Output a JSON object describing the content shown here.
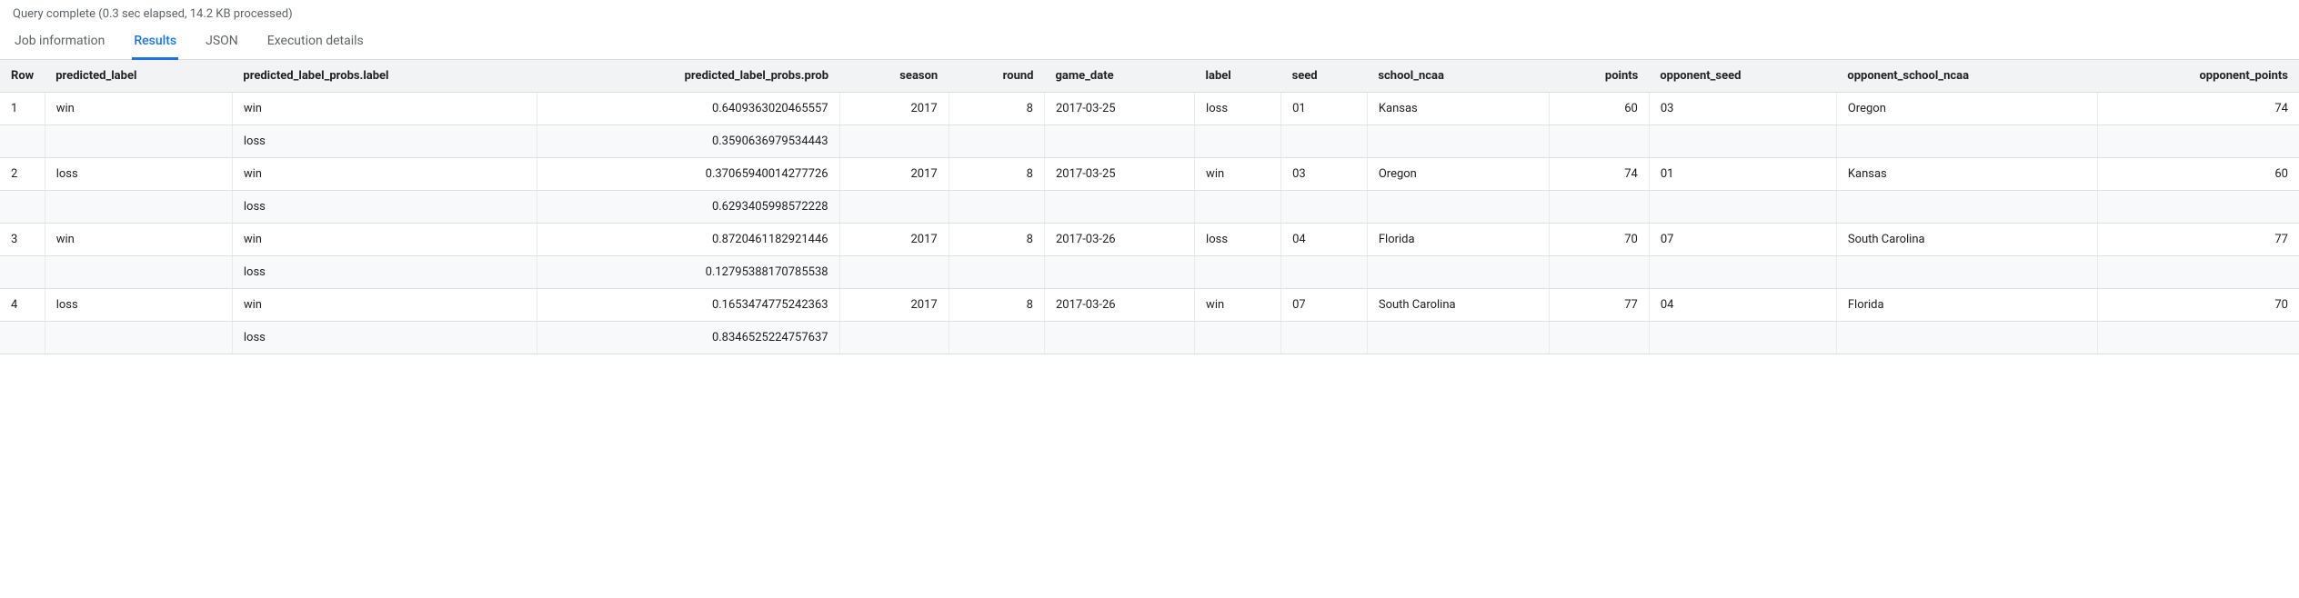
{
  "status": "Query complete (0.3 sec elapsed, 14.2 KB processed)",
  "tabs": {
    "job_info": "Job information",
    "results": "Results",
    "json": "JSON",
    "execution": "Execution details"
  },
  "columns": {
    "row": "Row",
    "predicted_label": "predicted_label",
    "probs_label": "predicted_label_probs.label",
    "probs_prob": "predicted_label_probs.prob",
    "season": "season",
    "round": "round",
    "game_date": "game_date",
    "label": "label",
    "seed": "seed",
    "school": "school_ncaa",
    "points": "points",
    "opp_seed": "opponent_seed",
    "opp_school": "opponent_school_ncaa",
    "opp_points": "opponent_points"
  },
  "rows": [
    {
      "row": "1",
      "predicted_label": "win",
      "probs": [
        {
          "label": "win",
          "prob": "0.6409363020465557"
        },
        {
          "label": "loss",
          "prob": "0.3590636979534443"
        }
      ],
      "season": "2017",
      "round": "8",
      "game_date": "2017-03-25",
      "label": "loss",
      "seed": "01",
      "school": "Kansas",
      "points": "60",
      "opp_seed": "03",
      "opp_school": "Oregon",
      "opp_points": "74"
    },
    {
      "row": "2",
      "predicted_label": "loss",
      "probs": [
        {
          "label": "win",
          "prob": "0.37065940014277726"
        },
        {
          "label": "loss",
          "prob": "0.6293405998572228"
        }
      ],
      "season": "2017",
      "round": "8",
      "game_date": "2017-03-25",
      "label": "win",
      "seed": "03",
      "school": "Oregon",
      "points": "74",
      "opp_seed": "01",
      "opp_school": "Kansas",
      "opp_points": "60"
    },
    {
      "row": "3",
      "predicted_label": "win",
      "probs": [
        {
          "label": "win",
          "prob": "0.8720461182921446"
        },
        {
          "label": "loss",
          "prob": "0.12795388170785538"
        }
      ],
      "season": "2017",
      "round": "8",
      "game_date": "2017-03-26",
      "label": "loss",
      "seed": "04",
      "school": "Florida",
      "points": "70",
      "opp_seed": "07",
      "opp_school": "South Carolina",
      "opp_points": "77"
    },
    {
      "row": "4",
      "predicted_label": "loss",
      "probs": [
        {
          "label": "win",
          "prob": "0.1653474775242363"
        },
        {
          "label": "loss",
          "prob": "0.8346525224757637"
        }
      ],
      "season": "2017",
      "round": "8",
      "game_date": "2017-03-26",
      "label": "win",
      "seed": "07",
      "school": "South Carolina",
      "points": "77",
      "opp_seed": "04",
      "opp_school": "Florida",
      "opp_points": "70"
    }
  ]
}
